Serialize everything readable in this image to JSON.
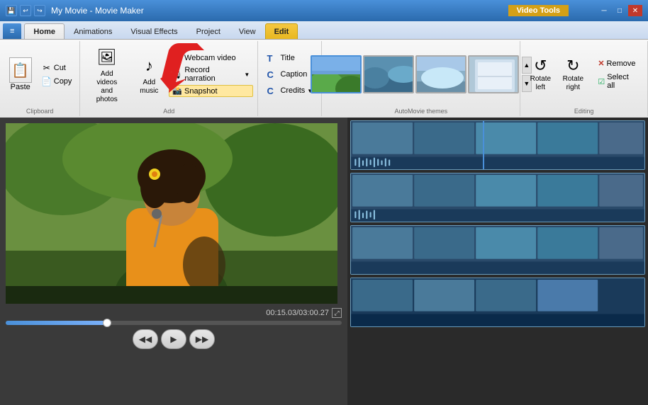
{
  "titleBar": {
    "appName": "My Movie - Movie Maker",
    "videoToolsLabel": "Video Tools",
    "icons": [
      "save",
      "undo",
      "redo"
    ]
  },
  "tabs": {
    "main": [
      "Home",
      "Animations",
      "Visual Effects",
      "Project",
      "View"
    ],
    "contextual": "Edit",
    "active": "Home",
    "contextualGroup": "Video Tools"
  },
  "ribbon": {
    "groups": {
      "clipboard": {
        "label": "Clipboard",
        "paste": "Paste",
        "cut": "Cut",
        "copy": "Copy"
      },
      "add": {
        "label": "Add",
        "addVideosAndPhotos": "Add videos\nand photos",
        "addMusic": "Add\nmusic",
        "webcamVideo": "Webcam video",
        "recordNarration": "Record narration",
        "snapshot": "Snapshot"
      },
      "text": {
        "title": "Title",
        "caption": "Caption",
        "credits": "Credits"
      },
      "automovie": {
        "label": "AutoMovie themes"
      },
      "editing": {
        "label": "Editing",
        "rotateLeft": "Rotate\nleft",
        "rotateRight": "Rotate\nright",
        "remove": "Remove",
        "selectAll": "Select all"
      }
    }
  },
  "preview": {
    "timeDisplay": "00:15.03/03:00.27",
    "expandTooltip": "Expand"
  },
  "transport": {
    "rewind": "⏮",
    "play": "▶",
    "fastForward": "⏭"
  },
  "icons": {
    "cut": "✂",
    "copy": "📋",
    "paste": "📋",
    "webcam": "📷",
    "music": "♪",
    "narration": "🎙",
    "camera": "📷",
    "title": "T",
    "caption": "C",
    "credits": "C",
    "rotateLeft": "↺",
    "rotateRight": "↻",
    "remove": "✕",
    "selectAll": "☑",
    "expand": "⤢",
    "scrollUp": "▲",
    "scrollDown": "▼",
    "appMenu": "▼"
  }
}
